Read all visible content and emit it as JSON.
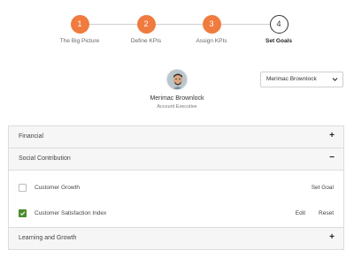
{
  "stepper": {
    "steps": [
      {
        "number": "1",
        "label": "The Big Picture",
        "state": "done"
      },
      {
        "number": "2",
        "label": "Define KPIs",
        "state": "done"
      },
      {
        "number": "3",
        "label": "Assign KPIs",
        "state": "done"
      },
      {
        "number": "4",
        "label": "Set Goals",
        "state": "current"
      }
    ],
    "colors": {
      "done": "#f07b3f",
      "current": "#ffffff"
    }
  },
  "user": {
    "name": "Merimac Brownlock",
    "role": "Account Executive",
    "avatar_icon": "user-avatar"
  },
  "user_select": {
    "selected": "Merimac Brownlock",
    "icon": "chevron-down-icon"
  },
  "accordion": {
    "sections": [
      {
        "title": "Financial",
        "toggle": "+",
        "expanded": false
      },
      {
        "title": "Social Contribution",
        "toggle": "−",
        "expanded": true,
        "kpis": [
          {
            "label": "Customer Growth",
            "checked": false,
            "actions": [
              "Set Goal"
            ]
          },
          {
            "label": "Customer Satisfaction Index",
            "checked": true,
            "actions": [
              "Edit",
              "Reset"
            ]
          }
        ]
      },
      {
        "title": "Learning and Growth",
        "toggle": "+",
        "expanded": false
      }
    ]
  },
  "colors": {
    "accent": "#f07b3f",
    "check": "#4a8b2c"
  }
}
